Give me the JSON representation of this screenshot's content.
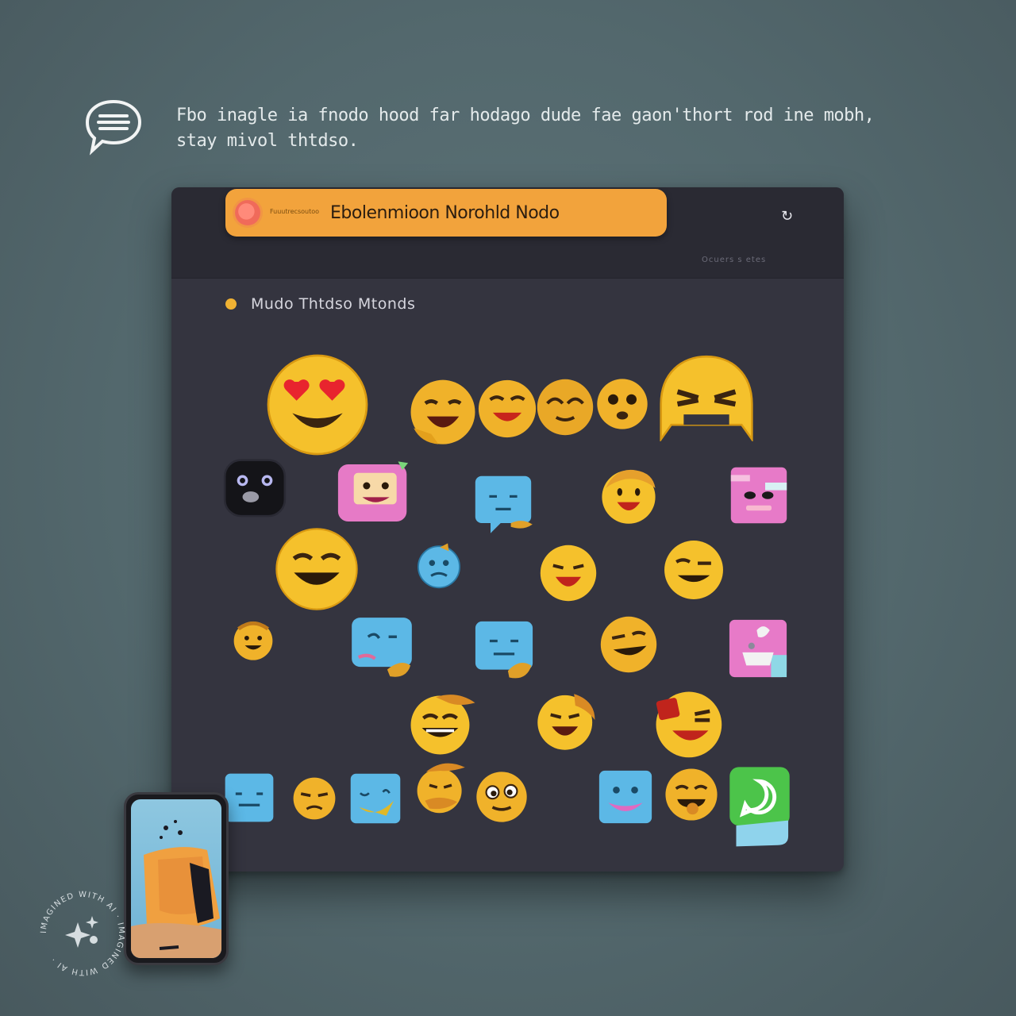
{
  "caption": {
    "line1": "Fbo inagle ia fnodo hood far hodago dude fae gaon'thort rod ine mobh,",
    "line2": "stay mivol thtdso."
  },
  "window": {
    "header": {
      "pill_small_text": "Fuuutrecsoutoo",
      "pill_title": "Ebolenmioon Norohld Nodo",
      "refresh_icon": "↻",
      "meta_text": "Ocuers s etes"
    },
    "section_title": "Mudo Thtdso Mtonds"
  },
  "icons": {
    "logo": "chat-bubble-icon",
    "watermark": "ai-sparkle-icon"
  },
  "watermark_text": "IMAGINED WITH AI · IMAGINED WITH AI ·",
  "colors": {
    "background": "#53686d",
    "panel": "#34343f",
    "header_pill": "#f2a33c",
    "emoji_yellow": "#f5c12c",
    "emoji_blue": "#5cb8e6",
    "emoji_pink": "#e77ac8",
    "whatsapp_green": "#4cc44a"
  }
}
